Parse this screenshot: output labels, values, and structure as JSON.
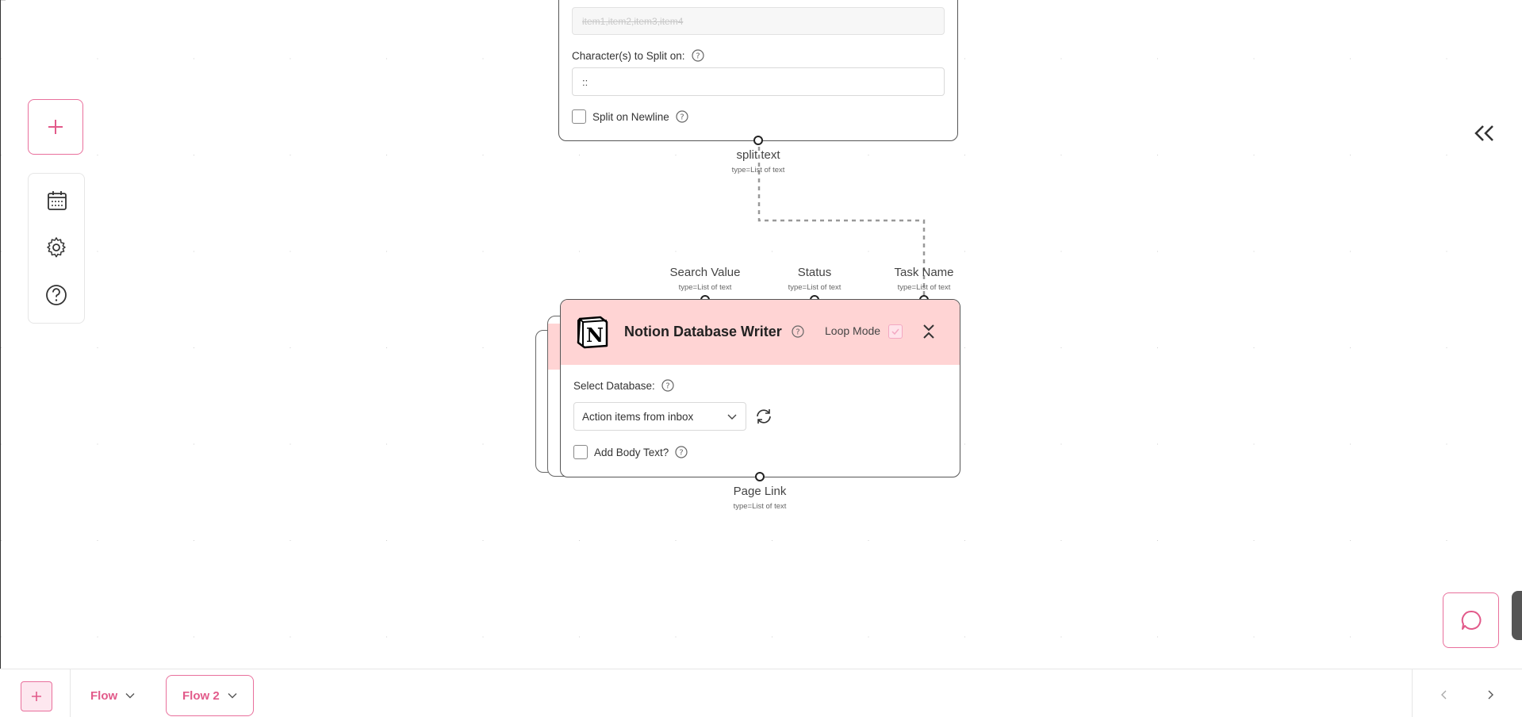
{
  "toolbar": {
    "add_icon": "plus-icon",
    "items": [
      {
        "name": "calendar",
        "icon": "calendar-icon"
      },
      {
        "name": "settings",
        "icon": "gear-icon"
      },
      {
        "name": "help",
        "icon": "help-circle-icon"
      }
    ]
  },
  "split_node": {
    "text_placeholder": "item1,item2,item3,item4",
    "split_chars_label": "Character(s) to Split on:",
    "split_chars_value": "::",
    "newline_label": "Split on Newline",
    "output": {
      "name": "split text",
      "type": "type=List of text"
    }
  },
  "notion_node": {
    "title": "Notion Database Writer",
    "loop_mode_label": "Loop Mode",
    "select_db_label": "Select Database:",
    "select_db_value": "Action items from inbox",
    "body_text_label": "Add Body Text?",
    "inputs": [
      {
        "name": "Search Value",
        "type": "type=List of text"
      },
      {
        "name": "Status",
        "type": "type=List of text"
      },
      {
        "name": "Task Name",
        "type": "type=List of text"
      }
    ],
    "output": {
      "name": "Page Link",
      "type": "type=List of text"
    }
  },
  "bottom_bar": {
    "tabs": [
      {
        "label": "Flow",
        "active": false
      },
      {
        "label": "Flow 2",
        "active": true
      }
    ]
  },
  "colors": {
    "accent": "#e25a8a",
    "node_header": "#ffd4d4",
    "connector": "#999999"
  }
}
